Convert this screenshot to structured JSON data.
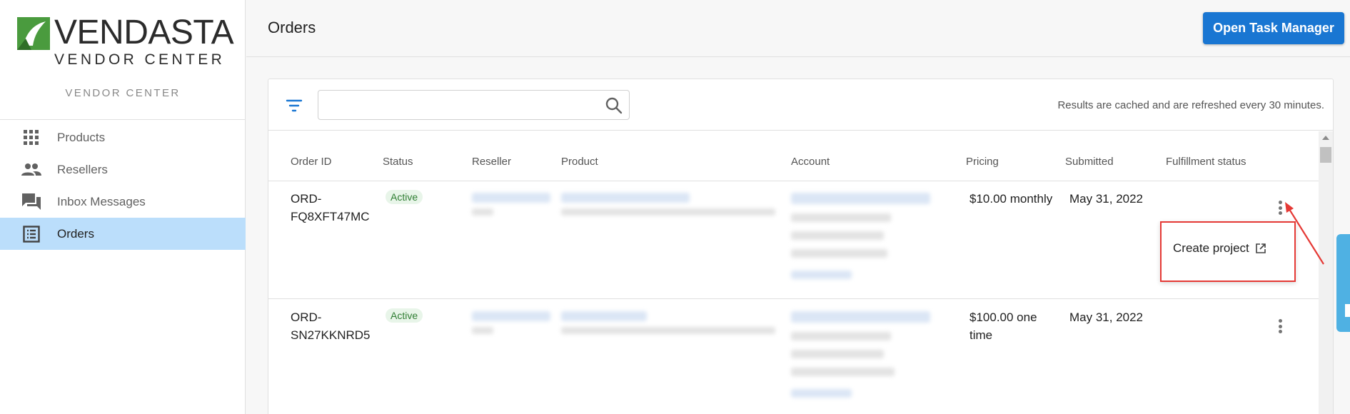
{
  "brand": {
    "name": "VENDASTA",
    "subtitle": "VENDOR CENTER",
    "caption": "VENDOR CENTER",
    "green": "#4a9b3e"
  },
  "sidebar": {
    "items": [
      {
        "label": "Products",
        "icon": "grid-icon",
        "active": false
      },
      {
        "label": "Resellers",
        "icon": "people-icon",
        "active": false
      },
      {
        "label": "Inbox Messages",
        "icon": "chat-icon",
        "active": false
      },
      {
        "label": "Orders",
        "icon": "list-icon",
        "active": true
      }
    ]
  },
  "header": {
    "title": "Orders",
    "task_manager_label": "Open Task Manager"
  },
  "toolbar": {
    "search_value": "",
    "search_placeholder": "",
    "cache_note": "Results are cached and are refreshed every 30 minutes."
  },
  "table": {
    "columns": [
      "Order ID",
      "Status",
      "Reseller",
      "Product",
      "Account",
      "Pricing",
      "Submitted",
      "Fulfillment status"
    ],
    "rows": [
      {
        "order_id_line1": "ORD-",
        "order_id_line2": "FQ8XFT47MC",
        "status": "Active",
        "pricing_line1": "$10.00 monthly",
        "pricing_line2": "",
        "submitted": "May 31, 2022"
      },
      {
        "order_id_line1": "ORD-",
        "order_id_line2": "SN27KKNRD5",
        "status": "Active",
        "pricing_line1": "$100.00 one",
        "pricing_line2": "time",
        "submitted": "May 31, 2022"
      }
    ]
  },
  "popup": {
    "create_project_label": "Create project"
  },
  "colors": {
    "accent": "#1976d2",
    "active_nav": "#bbdefb",
    "status_green": "#2e7d32",
    "highlight_red": "#e53935"
  }
}
